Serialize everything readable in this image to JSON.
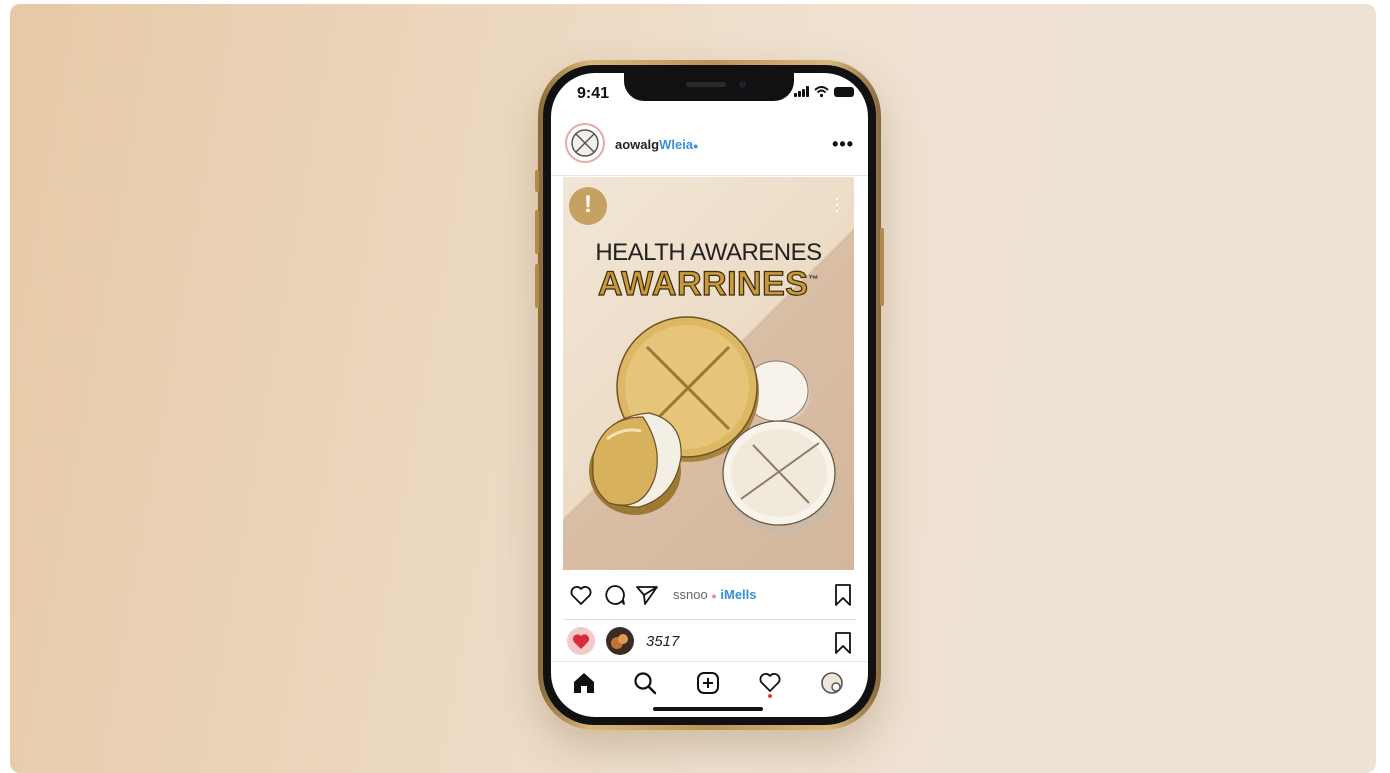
{
  "status_bar": {
    "time": "9:41"
  },
  "post": {
    "username_prefix": "aowalg",
    "username_suffix": "Wleia",
    "more_label": "•••",
    "image": {
      "headline_line1": "HEALTH AWARENES",
      "headline_line2": "AWARRINES",
      "trademark": "™",
      "badge_glyph": "!"
    },
    "liked_by_prefix": "ssnoo",
    "liked_by_name": "iMells",
    "like_count": "3517"
  },
  "colors": {
    "accent_gold": "#c99a3a",
    "link_blue": "#3a8fd8",
    "notification_red": "#e33b3b"
  },
  "icons": {
    "like": "heart-icon",
    "comment": "comment-icon",
    "share": "send-icon",
    "save": "bookmark-icon",
    "home": "home-icon",
    "search": "search-icon",
    "create": "add-post-icon",
    "activity": "heart-icon",
    "profile": "profile-icon"
  }
}
